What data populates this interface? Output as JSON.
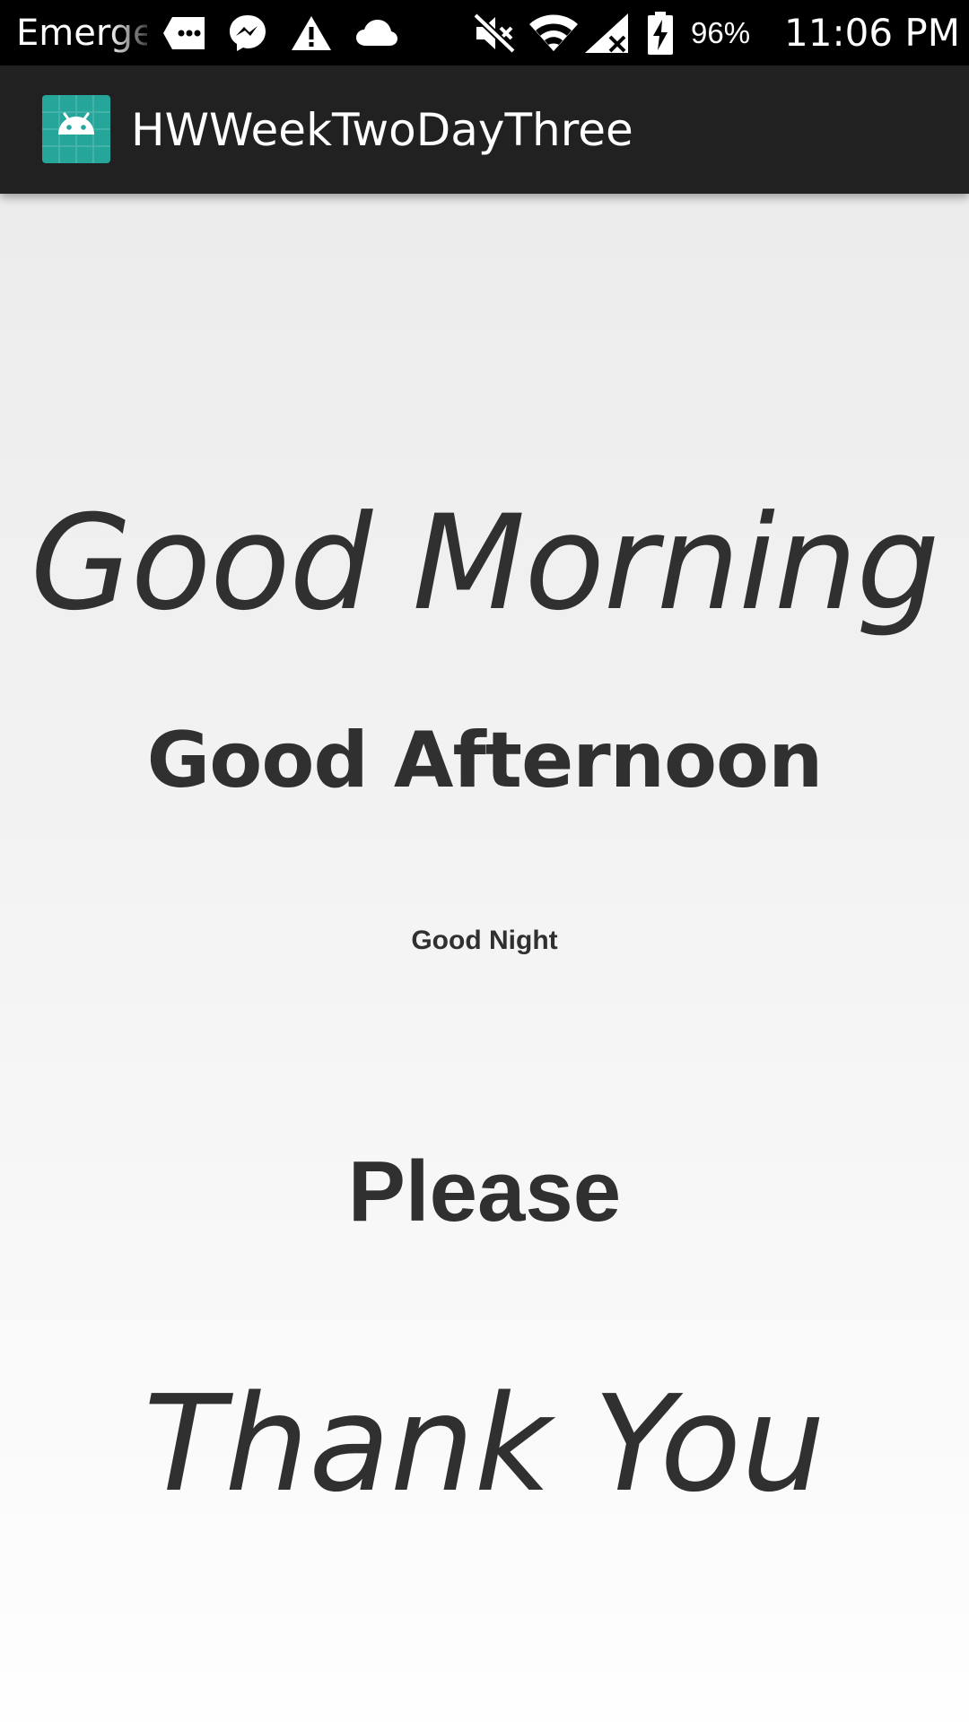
{
  "status_bar": {
    "carrier": "Emerge",
    "battery_percent": "96%",
    "time": "11:06 PM",
    "icons": [
      "message-icon",
      "messenger-icon",
      "warning-icon",
      "cloud-icon",
      "mute-icon",
      "wifi-icon",
      "signal-icon",
      "battery-charging-icon"
    ]
  },
  "app_bar": {
    "title": "HWWeekTwoDayThree",
    "icon": "android-icon",
    "color": "#212121"
  },
  "content": {
    "good_morning": "Good Morning",
    "good_afternoon": "Good Afternoon",
    "good_night": "Good Night",
    "please": "Please",
    "thank_you": "Thank You"
  },
  "colors": {
    "text": "#303030",
    "app_icon_bg": "#26a69a"
  }
}
